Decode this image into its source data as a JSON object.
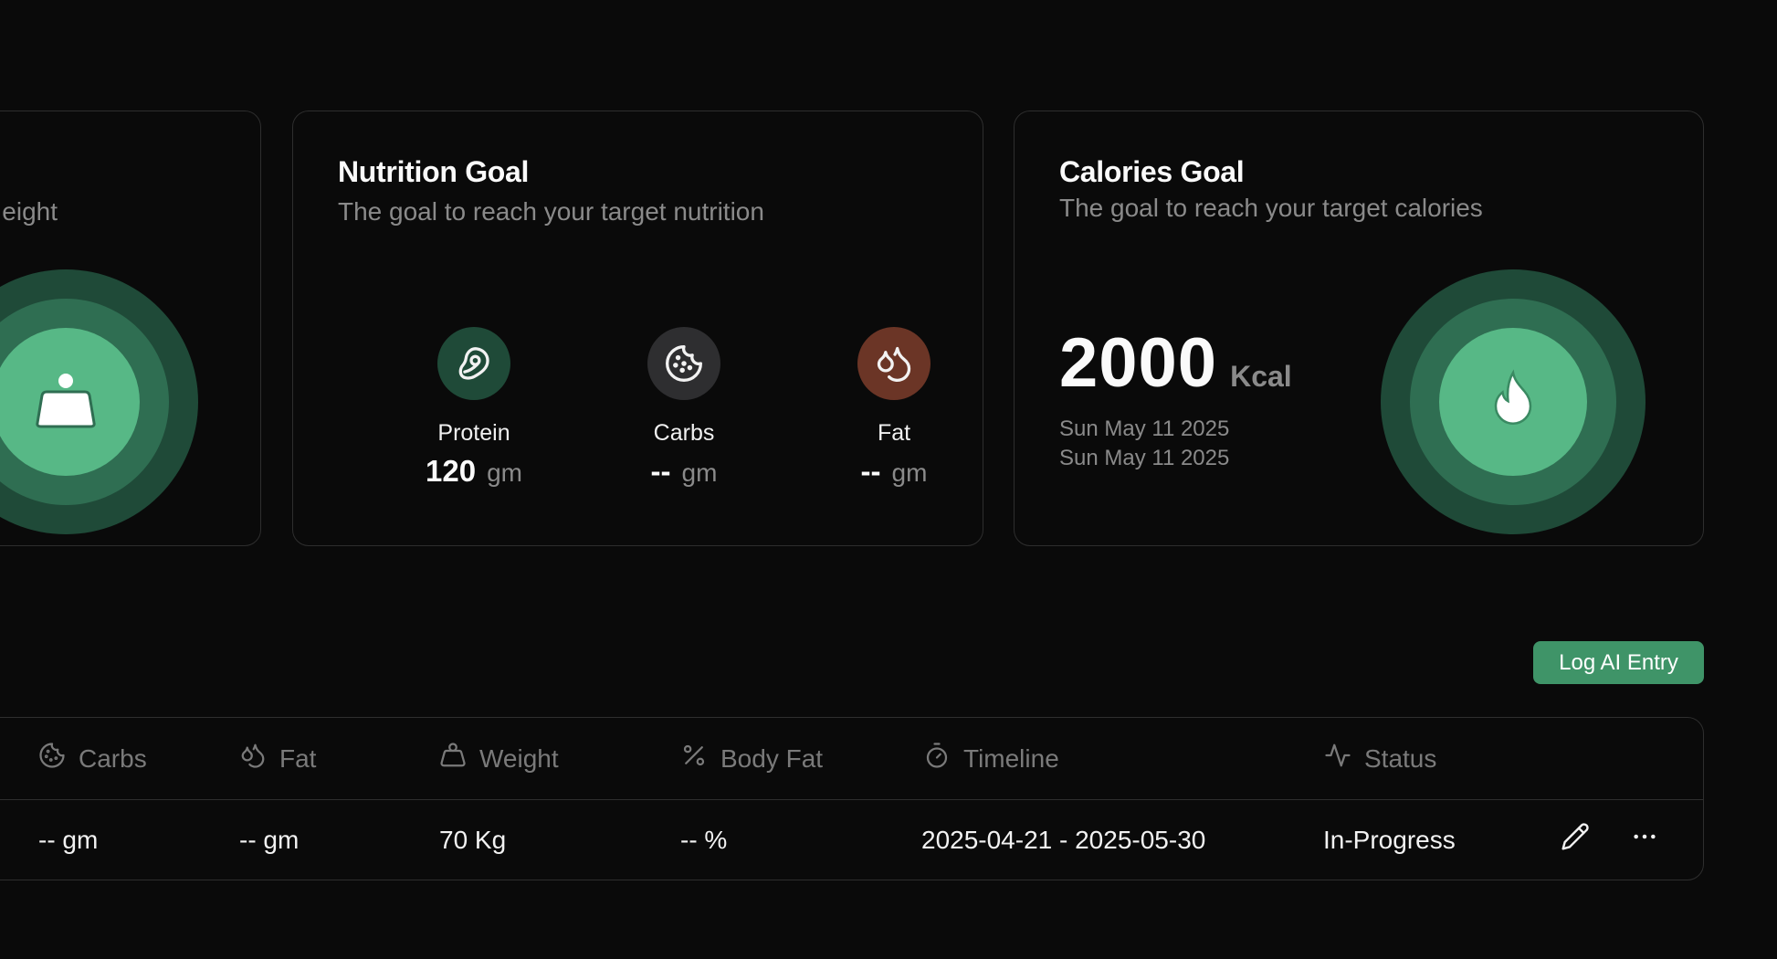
{
  "weight_card": {
    "subtitle_partial": "eight",
    "icon": "weight-icon"
  },
  "nutrition_card": {
    "title": "Nutrition Goal",
    "subtitle": "The goal to reach your target nutrition",
    "macros": [
      {
        "label": "Protein",
        "value": "120",
        "unit": "gm",
        "icon": "meat-icon",
        "color": "#1f4a38"
      },
      {
        "label": "Carbs",
        "value": "--",
        "unit": "gm",
        "icon": "cookie-icon",
        "color": "#2e2e30"
      },
      {
        "label": "Fat",
        "value": "--",
        "unit": "gm",
        "icon": "droplets-icon",
        "color": "#6b3526"
      }
    ]
  },
  "calories_card": {
    "title": "Calories Goal",
    "subtitle": "The goal to reach your target calories",
    "value": "2000",
    "unit": "Kcal",
    "start_date": "Sun May 11 2025",
    "end_date": "Sun May 11 2025",
    "icon": "flame-icon"
  },
  "actions": {
    "log_ai_entry": "Log AI Entry"
  },
  "table": {
    "columns": [
      {
        "label": "Carbs",
        "icon": "cookie-icon"
      },
      {
        "label": "Fat",
        "icon": "droplets-icon"
      },
      {
        "label": "Weight",
        "icon": "weight-icon"
      },
      {
        "label": "Body Fat",
        "icon": "percent-icon"
      },
      {
        "label": "Timeline",
        "icon": "timer-icon"
      },
      {
        "label": "Status",
        "icon": "activity-icon"
      }
    ],
    "rows": [
      {
        "carbs": "-- gm",
        "fat": "-- gm",
        "weight": "70 Kg",
        "body_fat": "-- %",
        "timeline": "2025-04-21 - 2025-05-30",
        "status": "In-Progress"
      }
    ]
  },
  "colors": {
    "accent": "#3f9468",
    "ring_outer": "#1f4a38",
    "ring_middle": "#2f6e52",
    "ring_inner": "#57b886",
    "background": "#0a0a0a",
    "border": "#2e2e2e"
  }
}
